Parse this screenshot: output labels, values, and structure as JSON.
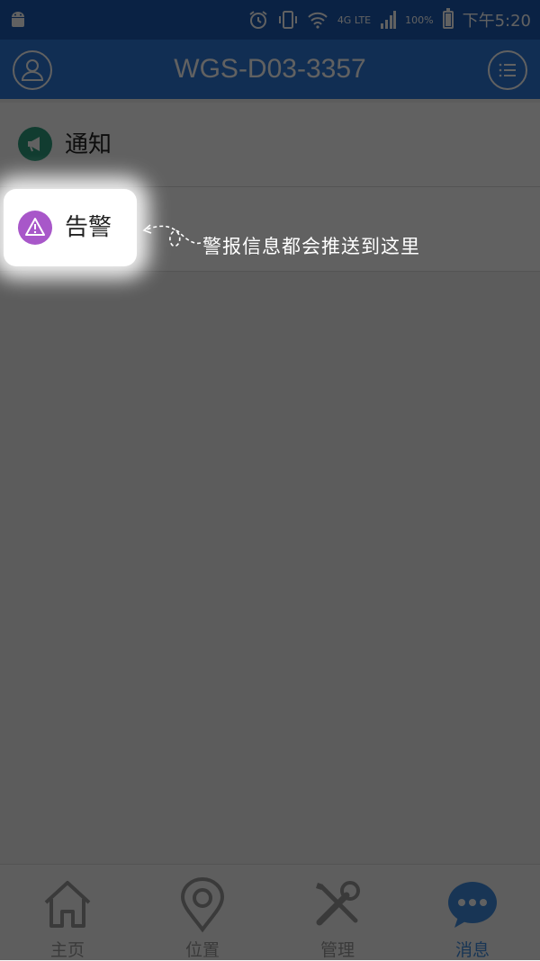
{
  "status_bar": {
    "network": "4G LTE",
    "battery": "100%",
    "time": "下午5:20"
  },
  "header": {
    "title": "WGS-D03-3357",
    "left_icon": "user-icon",
    "right_icon": "menu-list-icon"
  },
  "messages": [
    {
      "label": "通知",
      "icon": "megaphone-icon",
      "color": "#2e9f7f"
    },
    {
      "label": "告警",
      "icon": "warning-icon",
      "color": "#a857c9"
    }
  ],
  "tooltip": {
    "text": "警报信息都会推送到这里"
  },
  "bottom_nav": [
    {
      "label": "主页",
      "icon": "home-icon",
      "active": false
    },
    {
      "label": "位置",
      "icon": "location-pin-icon",
      "active": false
    },
    {
      "label": "管理",
      "icon": "tools-icon",
      "active": false
    },
    {
      "label": "消息",
      "icon": "chat-bubble-icon",
      "active": true
    }
  ],
  "colors": {
    "header": "#2f79d9",
    "active_tab": "#3f8de0"
  }
}
